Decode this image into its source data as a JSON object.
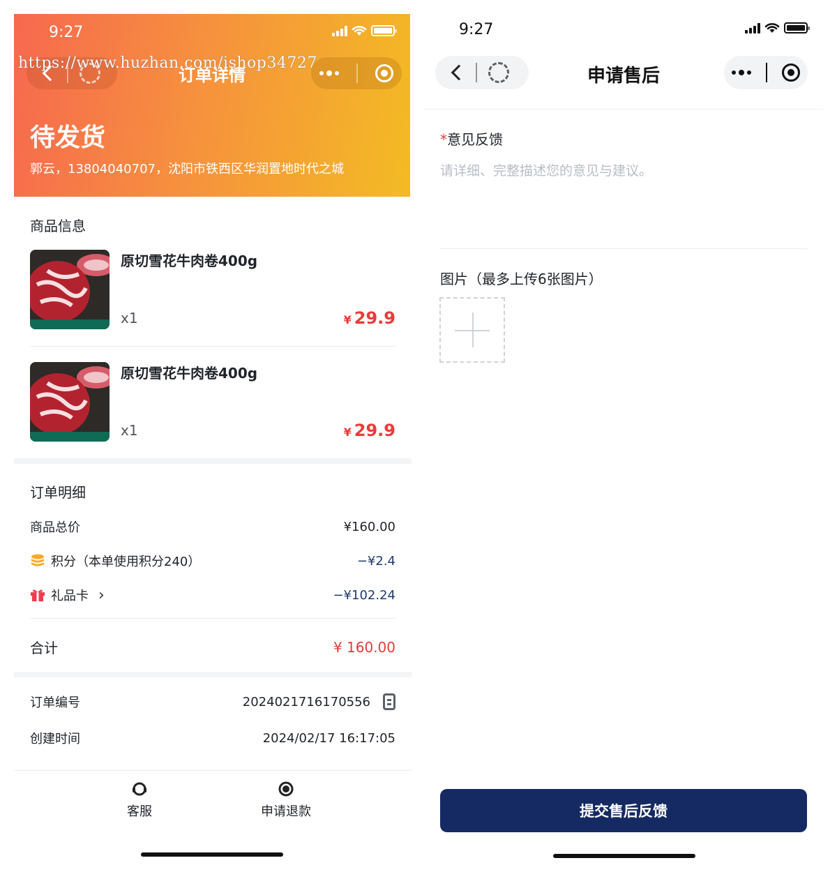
{
  "left": {
    "status": {
      "time": "9:27"
    },
    "nav": {
      "title": "订单详情"
    },
    "watermark": "https://www.huzhan.com/ishop34727",
    "order_status": "待发货",
    "address": "郭云，13804040707，沈阳市铁西区华润置地时代之城",
    "products_section": {
      "title": "商品信息"
    },
    "products": [
      {
        "name": "原切雪花牛肉卷400g",
        "qty": "x1",
        "currency": "¥",
        "price": "29.9"
      },
      {
        "name": "原切雪花牛肉卷400g",
        "qty": "x1",
        "currency": "¥",
        "price": "29.9"
      }
    ],
    "detail_section": {
      "title": "订单明细"
    },
    "details": {
      "goods_total_label": "商品总价",
      "goods_total_value": "¥160.00",
      "points_label": "积分（本单使用积分240）",
      "points_value": "−¥2.4",
      "giftcard_label": "礼品卡",
      "giftcard_chevron": "›",
      "giftcard_value": "−¥102.24",
      "total_label": "合计",
      "total_value": "¥ 160.00"
    },
    "meta": {
      "order_no_label": "订单编号",
      "order_no_value": "2024021716170556",
      "created_label": "创建时间",
      "created_value": "2024/02/17 16:17:05"
    },
    "tabbar": {
      "service": "客服",
      "refund": "申请退款"
    },
    "colors": {
      "hero_start": "#f7684f",
      "hero_end": "#f3bb24",
      "price": "#ec3a3a",
      "discount": "#1f3a70"
    }
  },
  "right": {
    "status": {
      "time": "9:27"
    },
    "nav": {
      "title": "申请售后"
    },
    "feedback": {
      "required_mark": "*",
      "label": "意见反馈",
      "placeholder": "请详细、完整描述您的意见与建议。"
    },
    "images": {
      "label": "图片（最多上传6张图片）"
    },
    "submit_label": "提交售后反馈",
    "colors": {
      "submit_bg": "#152a63"
    }
  }
}
